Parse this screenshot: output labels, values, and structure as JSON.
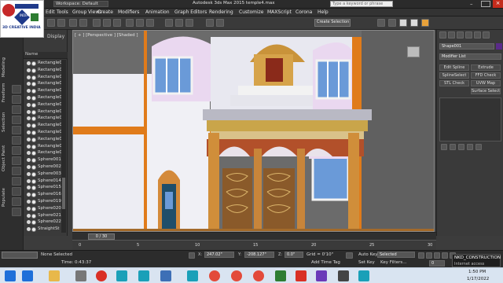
{
  "window": {
    "title": "Autodesk 3ds Max 2015   temple4.max",
    "workspace_label": "Workspace: Default",
    "search_placeholder": "Type a keyword or phrase"
  },
  "logo": {
    "text_top": "3D CREATIVE",
    "text_bottom": "3D CREATIVE INDIA",
    "badge": "INDIA"
  },
  "menu": [
    "Edit",
    "Tools",
    "Group",
    "Views",
    "Create",
    "Modifiers",
    "Animation",
    "Graph Editors",
    "Rendering",
    "Customize",
    "MAXScript",
    "Corona",
    "Help"
  ],
  "side_tabs": [
    "Modeling",
    "Freeform",
    "Selection",
    "Object Paint",
    "Populate"
  ],
  "explorer": {
    "display_label": "Display",
    "column_header": "Name",
    "items": [
      "Rectangle0",
      "Rectangle0",
      "Rectangle0",
      "Rectangle0",
      "Rectangle0",
      "Rectangle0",
      "Rectangle0",
      "Rectangle0",
      "Rectangle0",
      "Rectangle0",
      "Rectangle0",
      "Rectangle0",
      "Rectangle0",
      "Rectangle0",
      "Sphere001",
      "Sphere002",
      "Sphere003",
      "Sphere014",
      "Sphere015",
      "Sphere016",
      "Sphere019",
      "Sphere020",
      "Sphere021",
      "Sphere022",
      "StraightSt"
    ]
  },
  "viewport": {
    "label": "[ + ] [Perspective ] [Shaded ]"
  },
  "command_panel": {
    "object_name": "Shape001",
    "modifier_list": "Modifier List",
    "buttons": [
      "Edit Spline",
      "Extrude",
      "SplineSelect",
      "FFD Check",
      "STL Check",
      "UVW Map",
      "Surface Select"
    ]
  },
  "timeline": {
    "frame_label": "0 / 30",
    "ticks": [
      "0",
      "5",
      "10",
      "15",
      "20",
      "25",
      "30"
    ]
  },
  "status": {
    "selection": "None Selected",
    "time": "Time: 0:43:37",
    "x": "247.02\"",
    "y": "-208.127\"",
    "z": "0.0\"",
    "grid": "Grid = 0'10\"",
    "add_time_tag": "Add Time Tag",
    "auto_key": "Auto Key",
    "set_key": "Set Key",
    "selected": "Selected",
    "key_filters": "Key Filters...",
    "frame": "0"
  },
  "notification": {
    "title": "NKD_CONSTRUCTION",
    "subtitle": "Internet access"
  },
  "taskbar": {
    "time": "1:50 PM",
    "date": "1/17/2022"
  },
  "colors": {
    "accent_orange": "#e07b1a",
    "wall": "#e9e9f2",
    "panel": "#3a3a3a"
  }
}
